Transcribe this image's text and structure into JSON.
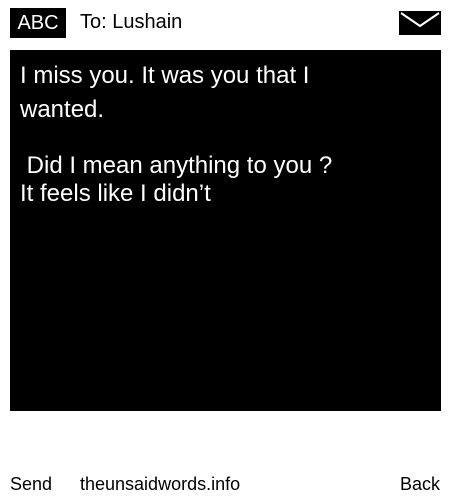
{
  "header": {
    "input_mode": "ABC",
    "recipient": "To: Lushain",
    "envelope_icon": "envelope-icon"
  },
  "message": {
    "lines": [
      "I miss you. It was you that I",
      "wanted.",
      " Did I mean anything to you ?",
      "It feels like I didn’t"
    ]
  },
  "softkeys": {
    "left": "Send",
    "center": "theunsaidwords.info",
    "right": "Back"
  },
  "colors": {
    "background": "#ffffff",
    "message_background": "#000000",
    "message_text": "#ffffff"
  }
}
